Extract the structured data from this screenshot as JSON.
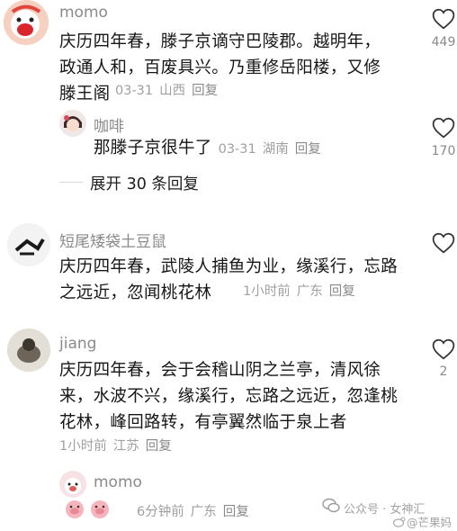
{
  "comments": [
    {
      "username": "momo",
      "text": "庆历四年春，滕子京谪守巴陵郡。越明年，政通人和，百废具兴。乃重修岳阳楼，又修滕王阁",
      "time": "03-31",
      "location": "山西",
      "reply_label": "回复",
      "likes": "449",
      "replies": [
        {
          "username": "咖啡",
          "text": "那滕子京很牛了",
          "time": "03-31",
          "location": "湖南",
          "reply_label": "回复",
          "likes": "170"
        }
      ],
      "expand_label": "展开 30 条回复"
    },
    {
      "username": "短尾矮袋土豆鼠",
      "text": "庆历四年春，武陵人捕鱼为业，缘溪行，忘路之远近，忽闻桃花林",
      "time": "1小时前",
      "location": "广东",
      "reply_label": "回复",
      "likes": ""
    },
    {
      "username": "jiang",
      "text": "庆历四年春，会于会稽山阴之兰亭，清风徐来，水波不兴，缘溪行，忘路之远近，忽逢桃花林，峰回路转，有亭翼然临于泉上者",
      "time": "1小时前",
      "location": "江苏",
      "reply_label": "回复",
      "likes": "2"
    },
    {
      "username": "momo",
      "time": "6分钟前",
      "location": "广东",
      "reply_label": "回复",
      "likes": ""
    }
  ],
  "watermark": {
    "account": "公众号 · 女神汇",
    "weibo": "@芒果妈"
  },
  "icons": {
    "like": "heart-outline-icon",
    "wechat": "wechat-icon",
    "weibo": "weibo-icon"
  }
}
